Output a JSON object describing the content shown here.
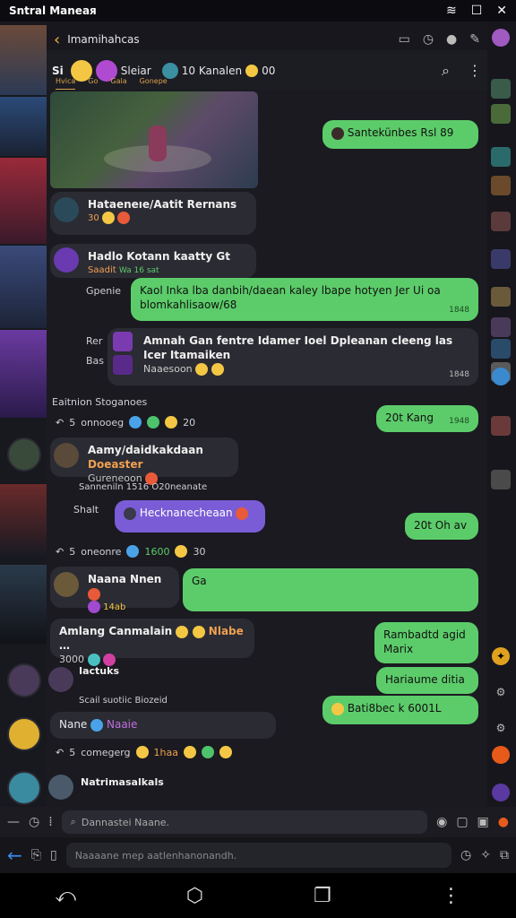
{
  "status_bar": {
    "title": "Sntral Maneaя",
    "icons": [
      "wifi-icon",
      "square-icon",
      "close-icon"
    ]
  },
  "top_bar": {
    "title": "Imamihahcas",
    "back": "‹"
  },
  "chat_header": {
    "left_label": "Si",
    "chips": [
      {
        "label": "Sleiar"
      },
      {
        "label": "10  Kanalen"
      },
      {
        "label": "00"
      }
    ],
    "subtabs": [
      "Hvica",
      "Go",
      "Gala",
      "Gonepe"
    ]
  },
  "messages": {
    "out1": {
      "text": "Santekünbes  Rsl  89",
      "time": ""
    },
    "in1": {
      "name": "Hataeneıe/Aatit  Rernans",
      "sub": "30"
    },
    "in2": {
      "name": "Hadlo Kotann kaatty  Gt",
      "sub": "Saadit",
      "extra": "Wa 16 sat"
    },
    "sys1": "Gpenie",
    "out2": {
      "text": "Kaol  Inka  lba  danbih/daean  kaley  lbape  hotyen  Jer  Ui  oa  blomkahlisaow/68",
      "time": "1848"
    },
    "in3_label": "Rer",
    "in3": {
      "name": "Amnah Gan fentre Idamer Ioel Dpleanan  cleeng  las  Icer  Itamaiken",
      "sub": "Naaesoon",
      "time": "1848",
      "label2": "Bas"
    },
    "section_label": "Eaitnion  Stoganoes",
    "react1": {
      "prefix": "5",
      "text": "onnooeg",
      "count": "20"
    },
    "out3": {
      "text": "20t  Kang",
      "time": "1948"
    },
    "in4": {
      "name": "Aamy/daidkakdaan",
      "tag": "Doeaster",
      "sub": "Gureneoon"
    },
    "sys2": "Sanneniln  1516  O20neanate",
    "shalt": "Shalt",
    "purple": {
      "text": "Hecknanecheaan"
    },
    "out4": {
      "text": "20t  Oh  av"
    },
    "react2": {
      "prefix": "5",
      "text": "oneonre",
      "count1": "1600",
      "count2": "30"
    },
    "in5": {
      "name": "Naana  Nnen",
      "sub": "14ab"
    },
    "out5": {
      "text": "Ga"
    },
    "in6": {
      "name": "Amlang  Canmalain",
      "tag": "Nlabe",
      "sub": "3000"
    },
    "out6": {
      "text": "Rambadtd  agid  Marix"
    },
    "name7": "Iactuks",
    "sys3": "Scail  suotiic  Biozeid",
    "out7": {
      "text": "Hariaume  ditia"
    },
    "out8": {
      "text": "Bati8bec  k  6001L"
    },
    "in8": {
      "name": "Nane",
      "tag": "Naaie"
    },
    "react3": {
      "prefix": "5",
      "text": "comegerg",
      "count": "1haa"
    },
    "name9": "Natrimasalkals"
  },
  "composer": {
    "placeholder": "Dannastei  Naane."
  },
  "bottom": {
    "placeholder": "Naaaane  mep  aatlenhanonandh."
  },
  "colors": {
    "accent": "#5ccc6a",
    "purple": "#7a5cd6",
    "background": "#1a1a20"
  }
}
